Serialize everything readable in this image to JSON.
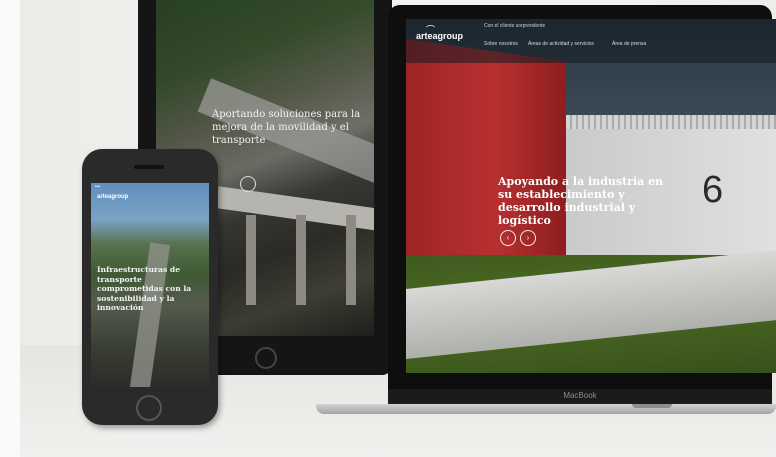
{
  "tablet": {
    "headline": "Aportando soluciones para la mejora de la movilidad y el transporte"
  },
  "laptop": {
    "logo": "arteagroup",
    "top_bar": "Con el cliente sorprendente",
    "nav": [
      "Sobre nosotros",
      "Áreas de actividad y servicios",
      "Área de prensa"
    ],
    "building_number": "6",
    "headline": "Apoyando a la industria en su establecimiento y desarrollo industrial y logístico",
    "brand": "MacBook"
  },
  "phone": {
    "status": "•••",
    "logo": "arteagroup",
    "headline": "Infraestructuras de transporte comprometidas con la sostenibilidad y la innovación"
  },
  "icons": {
    "prev": "‹",
    "next": "›"
  }
}
